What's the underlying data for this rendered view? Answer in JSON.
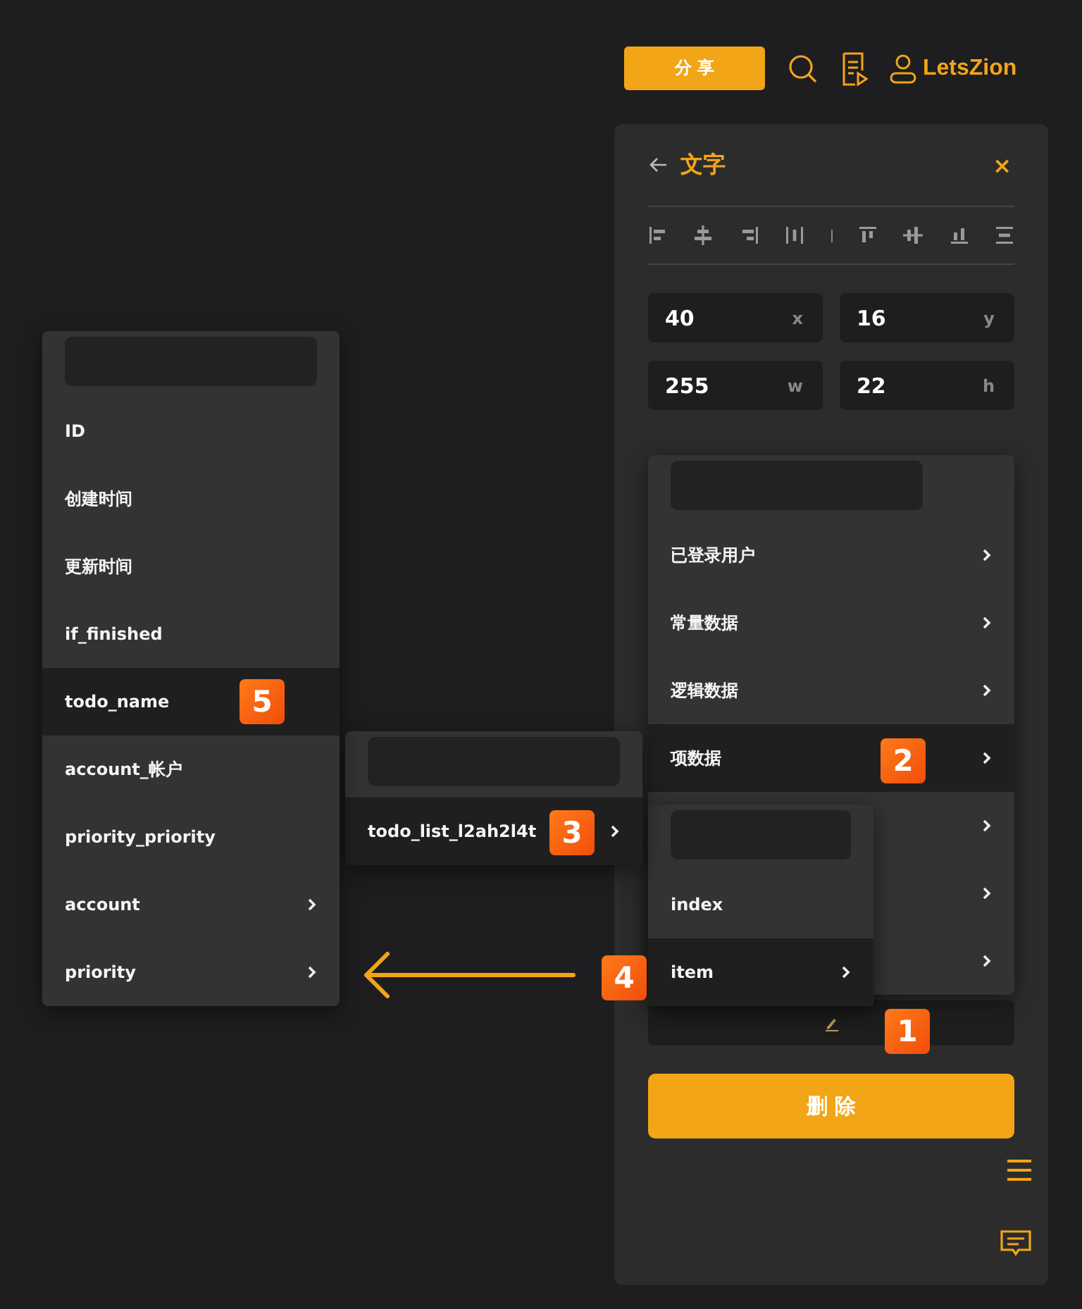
{
  "top_bar": {
    "share_button": "分 享",
    "user_name": "LetsZion"
  },
  "panel": {
    "title": "文字",
    "close": "×",
    "fields": [
      {
        "value": "40",
        "unit": "x"
      },
      {
        "value": "16",
        "unit": "y"
      },
      {
        "value": "255",
        "unit": "w"
      },
      {
        "value": "22",
        "unit": "h"
      }
    ],
    "delete_button": "删 除"
  },
  "menus": [
    {
      "items": [
        {
          "label": "已登录用户",
          "selected": false,
          "has_submenu": true
        },
        {
          "label": "常量数据",
          "selected": false,
          "has_submenu": true
        },
        {
          "label": "逻辑数据",
          "selected": false,
          "has_submenu": true
        },
        {
          "label": "项数据",
          "selected": true,
          "has_submenu": true
        },
        {
          "selected": false,
          "has_submenu": true
        },
        {
          "selected": false,
          "has_submenu": true
        },
        {
          "selected": false,
          "has_submenu": true
        }
      ]
    },
    {
      "items": [
        {
          "label": "index",
          "selected": false,
          "has_submenu": false
        },
        {
          "label": "item",
          "selected": true,
          "has_submenu": true
        }
      ]
    },
    {
      "items": [
        {
          "label": "todo_list_l2ah2l4t",
          "selected": true,
          "has_submenu": true
        }
      ]
    },
    {
      "items": [
        {
          "label": "ID",
          "selected": false,
          "has_submenu": false
        },
        {
          "label": "创建时间",
          "selected": false,
          "has_submenu": false
        },
        {
          "label": "更新时间",
          "selected": false,
          "has_submenu": false
        },
        {
          "label": "if_finished",
          "selected": false,
          "has_submenu": false
        },
        {
          "label": "todo_name",
          "selected": true,
          "has_submenu": false
        },
        {
          "label": "account_帐户",
          "selected": false,
          "has_submenu": false
        },
        {
          "label": "priority_priority",
          "selected": false,
          "has_submenu": false
        },
        {
          "label": "account",
          "selected": false,
          "has_submenu": true
        },
        {
          "label": "priority",
          "selected": false,
          "has_submenu": true
        }
      ]
    }
  ],
  "callouts": [
    {
      "label": "1"
    },
    {
      "label": "2"
    },
    {
      "label": "3"
    },
    {
      "label": "4"
    },
    {
      "label": "5"
    }
  ]
}
